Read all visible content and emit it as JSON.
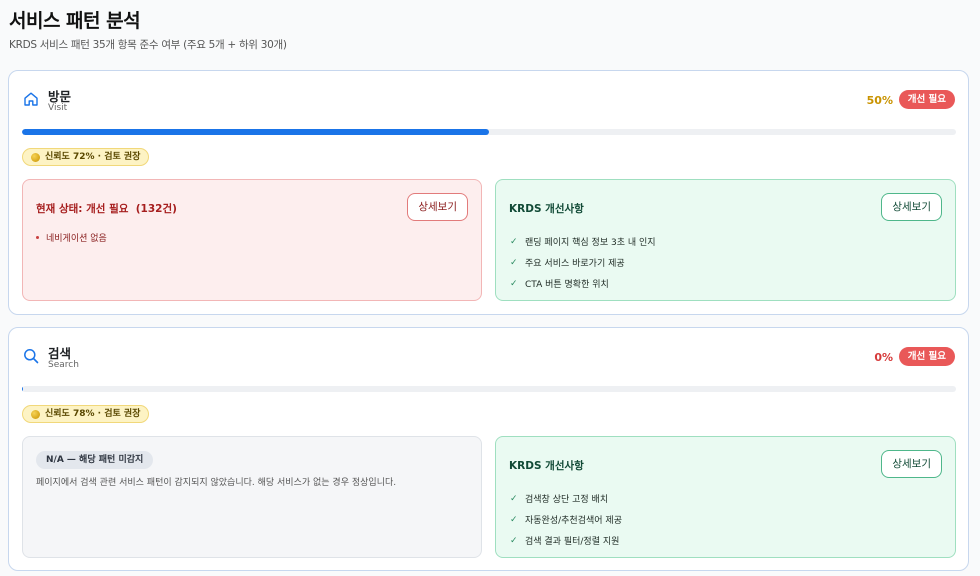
{
  "page": {
    "title": "서비스 패턴 분석",
    "subtitle": "KRDS 서비스 패턴 35개 항목 준수 여부 (주요 5개 + 하위 30개)"
  },
  "cards": [
    {
      "title": "방문",
      "subtitle": "Visit",
      "icon": "home-icon",
      "percent_label": "50%",
      "progress": 0.5,
      "status_badge": "개선 필요",
      "confidence": "신뢰도 72% · 검토 권장",
      "current": {
        "heading": "현재 상태: 개선 필요  (132건)",
        "button": "상세보기",
        "items": [
          "네비게이션 없음"
        ]
      },
      "krds": {
        "heading": "KRDS 개선사항",
        "button": "상세보기",
        "items": [
          "랜딩 페이지 핵심 정보 3초 내 인지",
          "주요 서비스 바로가기 제공",
          "CTA 버튼 명확한 위치"
        ]
      }
    },
    {
      "title": "검색",
      "subtitle": "Search",
      "icon": "search-icon",
      "percent_label": "0%",
      "progress": 0.0,
      "status_badge": "개선 필요",
      "confidence": "신뢰도 78% · 검토 권장",
      "current": {
        "chip": "N/A — 해당 패턴 미감지",
        "text": "페이지에서 검색 관련 서비스 패턴이 감지되지 않았습니다. 해당 서비스가 없는 경우 정상입니다."
      },
      "krds": {
        "heading": "KRDS 개선사항",
        "button": "상세보기",
        "items": [
          "검색창 상단 고정 배치",
          "자동완성/추천검색어 제공",
          "검색 결과 필터/정렬 지원"
        ]
      }
    }
  ],
  "colors": {
    "accent": "#1a74e8",
    "badge_red": "#e95858",
    "warn_text": "#c99300"
  }
}
